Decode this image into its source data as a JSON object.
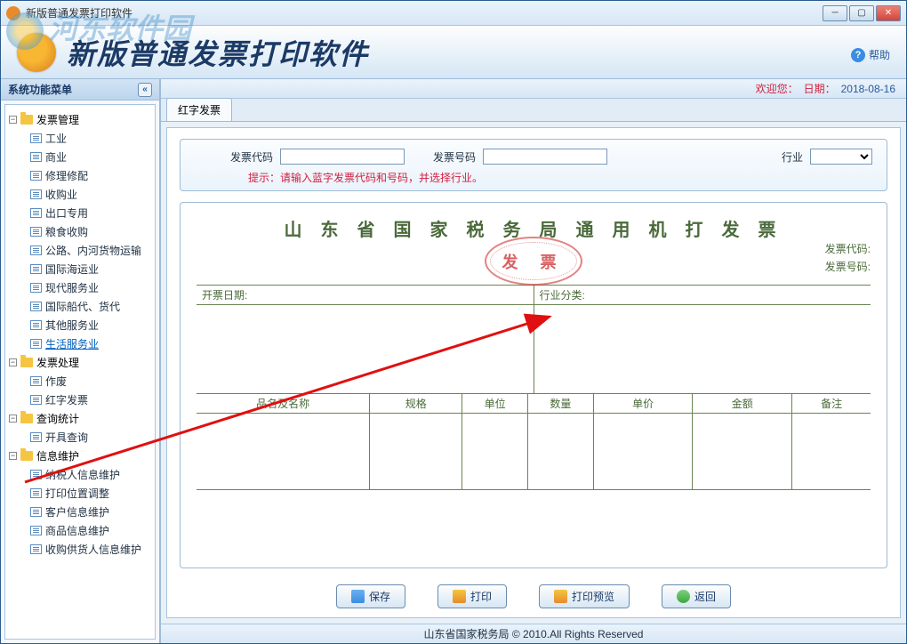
{
  "window": {
    "title": "新版普通发票打印软件"
  },
  "watermark": "河东软件园",
  "banner": {
    "title": "新版普通发票打印软件",
    "help": "帮助"
  },
  "status": {
    "welcome": "欢迎您：",
    "date_label": "日期：",
    "date": "2018-08-16"
  },
  "sidebar": {
    "header": "系统功能菜单",
    "groups": [
      {
        "label": "发票管理",
        "items": [
          "工业",
          "商业",
          "修理修配",
          "收购业",
          "出口专用",
          "粮食收购",
          "公路、内河货物运输",
          "国际海运业",
          "现代服务业",
          "国际船代、货代",
          "其他服务业",
          "生活服务业"
        ],
        "activeIndex": 11
      },
      {
        "label": "发票处理",
        "items": [
          "作废",
          "红字发票"
        ]
      },
      {
        "label": "查询统计",
        "items": [
          "开具查询"
        ]
      },
      {
        "label": "信息维护",
        "items": [
          "纳税人信息维护",
          "打印位置调整",
          "客户信息维护",
          "商品信息维护",
          "收购供货人信息维护"
        ]
      }
    ]
  },
  "tab": "红字发票",
  "form": {
    "code_label": "发票代码",
    "number_label": "发票号码",
    "industry_label": "行业",
    "hint": "提示：请输入蓝字发票代码和号码，并选择行业。"
  },
  "invoice": {
    "title": "山 东 省 国 家 税 务 局 通 用 机 打 发 票",
    "stamp": "发  票",
    "code_label": "发票代码:",
    "number_label": "发票号码:",
    "issue_date_label": "开票日期:",
    "industry_cat_label": "行业分类:",
    "cols": {
      "name": "品名及名称",
      "spec": "规格",
      "unit": "单位",
      "qty": "数量",
      "price": "单价",
      "amount": "金额",
      "note": "备注"
    }
  },
  "buttons": {
    "save": "保存",
    "print": "打印",
    "preview": "打印预览",
    "back": "返回"
  },
  "footer": "山东省国家税务局 © 2010.All Rights Reserved"
}
